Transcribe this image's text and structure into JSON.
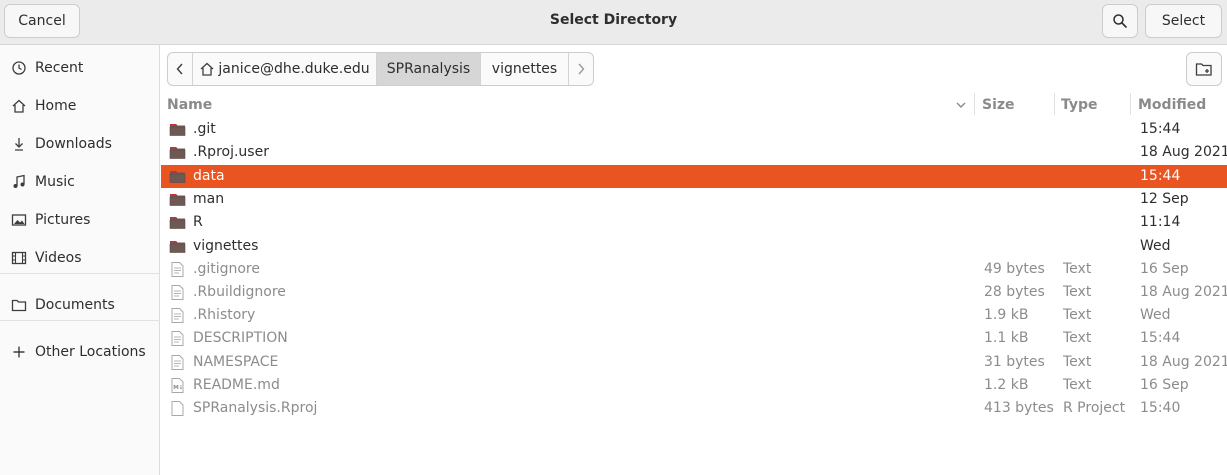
{
  "header": {
    "title": "Select Directory",
    "cancel_label": "Cancel",
    "select_label": "Select"
  },
  "sidebar": {
    "items": [
      {
        "label": "Recent",
        "icon": "clock-icon"
      },
      {
        "label": "Home",
        "icon": "home-icon"
      },
      {
        "label": "Downloads",
        "icon": "download-icon"
      },
      {
        "label": "Music",
        "icon": "music-icon"
      },
      {
        "label": "Pictures",
        "icon": "picture-icon"
      },
      {
        "label": "Videos",
        "icon": "film-icon"
      },
      {
        "label": "Documents",
        "icon": "folder-icon"
      },
      {
        "label": "Other Locations",
        "icon": "plus-icon"
      }
    ]
  },
  "pathbar": {
    "segments": [
      "janice@dhe.duke.edu",
      "SPRanalysis",
      "vignettes"
    ],
    "active_index": 1
  },
  "columns": {
    "name": "Name",
    "size": "Size",
    "type": "Type",
    "modified": "Modified"
  },
  "files": [
    {
      "name": ".git",
      "size": "",
      "type": "",
      "modified": "15:44",
      "kind": "folder"
    },
    {
      "name": ".Rproj.user",
      "size": "",
      "type": "",
      "modified": "18 Aug 2021",
      "kind": "folder"
    },
    {
      "name": "data",
      "size": "",
      "type": "",
      "modified": "15:44",
      "kind": "folder",
      "selected": true
    },
    {
      "name": "man",
      "size": "",
      "type": "",
      "modified": "12 Sep",
      "kind": "folder"
    },
    {
      "name": "R",
      "size": "",
      "type": "",
      "modified": "11:14",
      "kind": "folder"
    },
    {
      "name": "vignettes",
      "size": "",
      "type": "",
      "modified": "Wed",
      "kind": "folder"
    },
    {
      "name": ".gitignore",
      "size": "49 bytes",
      "type": "Text",
      "modified": "16 Sep",
      "kind": "text"
    },
    {
      "name": ".Rbuildignore",
      "size": "28 bytes",
      "type": "Text",
      "modified": "18 Aug 2021",
      "kind": "text"
    },
    {
      "name": ".Rhistory",
      "size": "1.9 kB",
      "type": "Text",
      "modified": "Wed",
      "kind": "text"
    },
    {
      "name": "DESCRIPTION",
      "size": "1.1 kB",
      "type": "Text",
      "modified": "15:44",
      "kind": "text"
    },
    {
      "name": "NAMESPACE",
      "size": "31 bytes",
      "type": "Text",
      "modified": "18 Aug 2021",
      "kind": "text"
    },
    {
      "name": "README.md",
      "size": "1.2 kB",
      "type": "Text",
      "modified": "16 Sep",
      "kind": "markdown"
    },
    {
      "name": "SPRanalysis.Rproj",
      "size": "413 bytes",
      "type": "R Project",
      "modified": "15:40",
      "kind": "blank"
    }
  ],
  "colors": {
    "selection": "#e95420",
    "folder": "#6e5a55",
    "folder_tab": "#c7303b"
  }
}
